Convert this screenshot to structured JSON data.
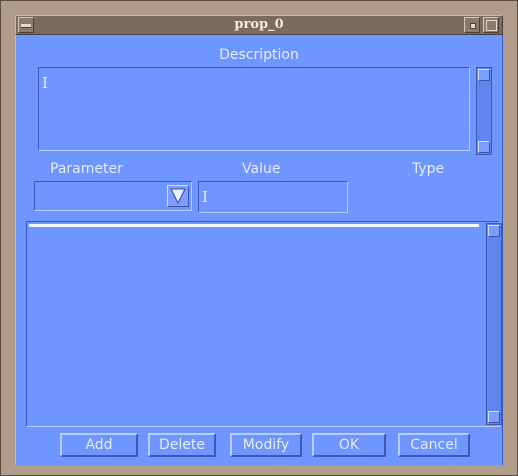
{
  "window": {
    "title": "prop_0"
  },
  "description": {
    "label": "Description",
    "value": ""
  },
  "columns": {
    "parameter": "Parameter",
    "value": "Value",
    "type": "Type"
  },
  "parameter_select": {
    "selected": ""
  },
  "value_field": {
    "value": ""
  },
  "list": {
    "items": []
  },
  "buttons": {
    "add": "Add",
    "delete": "Delete",
    "modify": "Modify",
    "ok": "OK",
    "cancel": "Cancel"
  },
  "colors": {
    "client_bg": "#6f95ff",
    "frame": "#b09c88",
    "titlebar": "#7d6a5c",
    "text": "#e6ecff"
  }
}
